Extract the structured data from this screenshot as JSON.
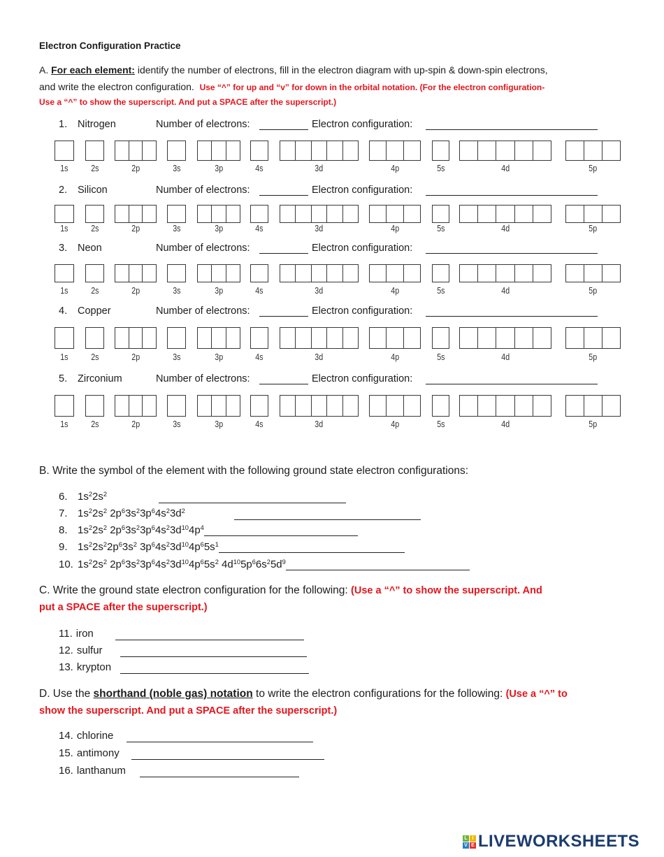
{
  "colors": {
    "instruction_red": "#e3161d",
    "brand_navy": "#1b3c6e",
    "logo_green": "#6cb33f",
    "logo_yellow": "#f2b705",
    "logo_blue": "#2c7fc6",
    "logo_red": "#e5322d"
  },
  "title": "Electron Configuration Practice",
  "sectionA": {
    "intro_lines": [
      [
        {
          "t": "A. ",
          "s": "normal"
        },
        {
          "t": "For each element:",
          "s": "bold-underline"
        },
        {
          "t": " identify the number of electrons, fill in the electron diagram with up-spin & down-spin electrons,",
          "s": "normal"
        }
      ],
      [
        {
          "t": "and write the electron configuration.  ",
          "s": "normal"
        },
        {
          "t": "Use “^” for up and “v” for down in the orbital notation. (For the electron configuration-",
          "s": "red"
        }
      ],
      [
        {
          "t": "Use a “^” to show the superscript. And put a SPACE after the superscript.)",
          "s": "red"
        }
      ]
    ],
    "electrons_label": "Number of electrons:",
    "config_label": "Electron configuration:",
    "orbitals": [
      {
        "name": "1s",
        "boxes": 1
      },
      {
        "name": "2s",
        "boxes": 1
      },
      {
        "name": "2p",
        "boxes": 3
      },
      {
        "name": "3s",
        "boxes": 1
      },
      {
        "name": "3p",
        "boxes": 3
      },
      {
        "name": "4s",
        "boxes": 1
      },
      {
        "name": "3d",
        "boxes": 5
      },
      {
        "name": "4p",
        "boxes": 3
      },
      {
        "name": "5s",
        "boxes": 1
      },
      {
        "name": "4d",
        "boxes": 5
      },
      {
        "name": "5p",
        "boxes": 3
      }
    ],
    "items": [
      {
        "number": "1.",
        "element": "Nitrogen",
        "electrons": "",
        "configuration": ""
      },
      {
        "number": "2.",
        "element": "Silicon",
        "electrons": "",
        "configuration": ""
      },
      {
        "number": "3.",
        "element": "Neon",
        "electrons": "",
        "configuration": ""
      },
      {
        "number": "4.",
        "element": "Copper",
        "electrons": "",
        "configuration": ""
      },
      {
        "number": "5.",
        "element": "Zirconium",
        "electrons": "",
        "configuration": ""
      }
    ]
  },
  "sectionB": {
    "heading": "B. Write the symbol of the element with the following ground state electron configurations:",
    "items": [
      {
        "number": "6.",
        "answer": "",
        "config": [
          [
            "1s",
            "2"
          ],
          [
            "2s",
            "2"
          ]
        ]
      },
      {
        "number": "7.",
        "answer": "",
        "config": [
          [
            "1s",
            "2"
          ],
          [
            "2s",
            "2"
          ],
          [
            " 2p",
            "6"
          ],
          [
            "3s",
            "2"
          ],
          [
            "3p",
            "6"
          ],
          [
            "4s",
            "2"
          ],
          [
            "3d",
            "2"
          ]
        ]
      },
      {
        "number": "8.",
        "answer": "",
        "config": [
          [
            "1s",
            "2"
          ],
          [
            "2s",
            "2"
          ],
          [
            " 2p",
            "6"
          ],
          [
            "3s",
            "2"
          ],
          [
            "3p",
            "6"
          ],
          [
            "4s",
            "2"
          ],
          [
            "3d",
            "10"
          ],
          [
            "4p",
            "4"
          ]
        ]
      },
      {
        "number": "9.",
        "answer": "",
        "config": [
          [
            "1s",
            "2"
          ],
          [
            "2s",
            "2"
          ],
          [
            "2p",
            "6"
          ],
          [
            "3s",
            "2"
          ],
          [
            " 3p",
            "6"
          ],
          [
            "4s",
            "2"
          ],
          [
            "3d",
            "10"
          ],
          [
            "4p",
            "6"
          ],
          [
            "5s",
            "1"
          ]
        ]
      },
      {
        "number": "10.",
        "answer": "",
        "config": [
          [
            "1s",
            "2"
          ],
          [
            "2s",
            "2"
          ],
          [
            " 2p",
            "6"
          ],
          [
            "3s",
            "2"
          ],
          [
            "3p",
            "6"
          ],
          [
            "4s",
            "2"
          ],
          [
            "3d",
            "10"
          ],
          [
            "4p",
            "6"
          ],
          [
            "5s",
            "2"
          ],
          [
            " 4d",
            "10"
          ],
          [
            "5p",
            "6"
          ],
          [
            "6s",
            "2"
          ],
          [
            "5d",
            "9"
          ]
        ]
      }
    ]
  },
  "sectionC": {
    "heading_lines": [
      [
        {
          "t": "C. Write the ground state electron configuration for the following: ",
          "s": "normal"
        },
        {
          "t": "(Use a “^” to show the superscript. And",
          "s": "red"
        }
      ],
      [
        {
          "t": "put a SPACE after the superscript.)",
          "s": "red"
        }
      ]
    ],
    "items": [
      {
        "number": "11.",
        "element": "iron",
        "answer": ""
      },
      {
        "number": "12.",
        "element": "sulfur",
        "answer": ""
      },
      {
        "number": "13.",
        "element": "krypton",
        "answer": ""
      }
    ]
  },
  "sectionD": {
    "heading_lines": [
      [
        {
          "t": "D. Use the ",
          "s": "normal"
        },
        {
          "t": "shorthand (noble gas) notation",
          "s": "bold-underline"
        },
        {
          "t": " to write the electron configurations for the following: ",
          "s": "normal"
        },
        {
          "t": "(Use a “^” to",
          "s": "red"
        }
      ],
      [
        {
          "t": "show the superscript. And put a SPACE after the superscript.)",
          "s": "red"
        }
      ]
    ],
    "items": [
      {
        "number": "14.",
        "element": "chlorine",
        "answer": ""
      },
      {
        "number": "15.",
        "element": "antimony",
        "answer": ""
      },
      {
        "number": "16.",
        "element": "lanthanum",
        "answer": ""
      }
    ]
  },
  "brand": {
    "icon_letters": [
      "L",
      "I",
      "V",
      "E"
    ],
    "name": "LIVEWORKSHEETS"
  }
}
